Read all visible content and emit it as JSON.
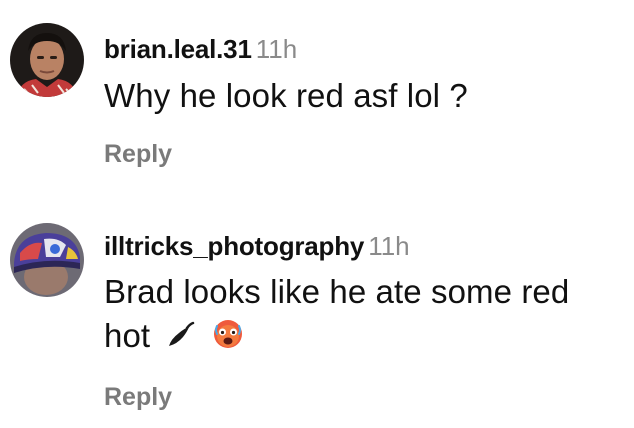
{
  "comments": [
    {
      "username": "brian.leal.31",
      "time": "11h",
      "text": "Why he look red asf lol ?",
      "reply_label": "Reply"
    },
    {
      "username": "illtricks_photography",
      "time": "11h",
      "text": "Brad looks like he ate some red hot",
      "emojis": [
        "hot-pepper-icon",
        "hot-face-icon"
      ],
      "reply_label": "Reply"
    }
  ],
  "colors": {
    "username": "#111111",
    "timestamp": "#8a8a8a",
    "reply": "#7a7a7a",
    "background": "#ffffff"
  }
}
